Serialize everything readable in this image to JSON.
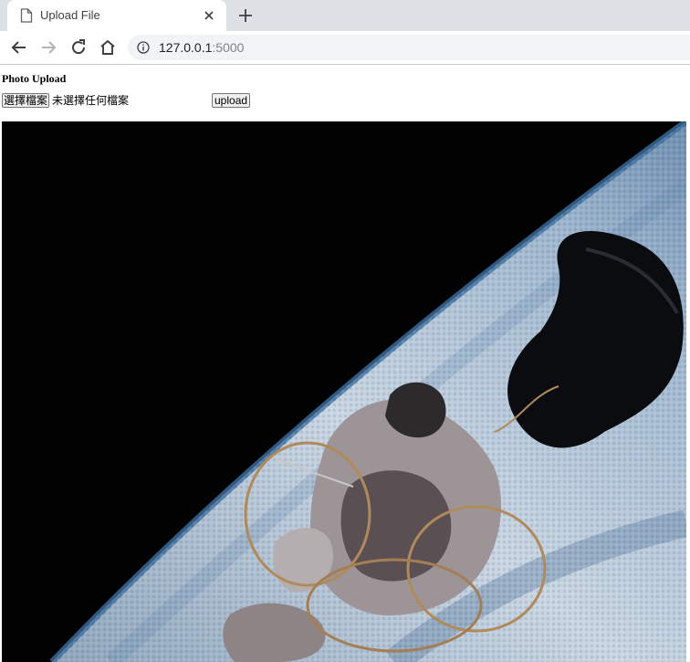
{
  "browser": {
    "tab_title": "Upload File",
    "url_host": "127.0.0.1",
    "url_port": ":5000",
    "icons": {
      "favicon": "page-icon",
      "close": "close-icon",
      "new_tab": "plus-icon",
      "back": "back-arrow-icon",
      "forward": "forward-arrow-icon",
      "reload": "reload-icon",
      "home": "home-icon",
      "site_info": "info-icon"
    }
  },
  "page": {
    "heading": "Photo Upload",
    "file_button_label": "選擇檔案",
    "file_status": "未選擇任何檔案",
    "upload_button_label": "upload"
  }
}
